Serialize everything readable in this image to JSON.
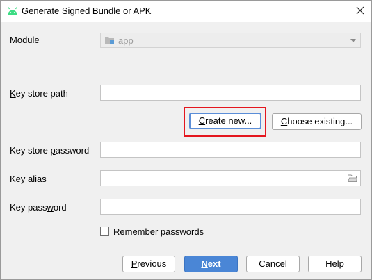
{
  "window": {
    "title": "Generate Signed Bundle or APK",
    "icon": "android-icon",
    "close_icon": "close-icon"
  },
  "module": {
    "label_prefix": "",
    "label_mnemonic": "M",
    "label_rest": "odule",
    "value": "app"
  },
  "key_store_path": {
    "label_mnemonic": "K",
    "label_rest": "ey store path",
    "value": ""
  },
  "keystore_buttons": {
    "create_new_mnemonic": "C",
    "create_new_rest": "reate new...",
    "choose_existing_mnemonic": "C",
    "choose_existing_rest": "hoose existing..."
  },
  "key_store_password": {
    "label_prefix": "Key store ",
    "label_mnemonic": "p",
    "label_rest": "assword",
    "value": ""
  },
  "key_alias": {
    "label_prefix": "K",
    "label_mnemonic": "e",
    "label_rest": "y alias",
    "value": ""
  },
  "key_password": {
    "label_prefix": "Key pass",
    "label_mnemonic": "w",
    "label_rest": "ord",
    "value": ""
  },
  "remember": {
    "label_mnemonic": "R",
    "label_rest": "emember passwords",
    "checked": false
  },
  "footer": {
    "previous_mnemonic": "P",
    "previous_rest": "revious",
    "next_mnemonic": "N",
    "next_rest": "ext",
    "cancel_label": "Cancel",
    "help_label": "Help"
  },
  "colors": {
    "highlight": "#e4161e",
    "primary": "#4a86d6",
    "android_green": "#3ddc84"
  }
}
